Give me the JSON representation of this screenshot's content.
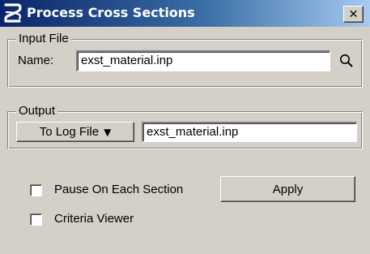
{
  "window": {
    "title": "Process Cross Sections",
    "close_glyph": "✕",
    "app_icon": "bentley-b-icon"
  },
  "input_file": {
    "group_label": "Input File",
    "name_label": "Name:",
    "name_value": "exst_material.inp",
    "browse_icon": "magnifier-icon"
  },
  "output": {
    "group_label": "Output",
    "mode_button_label": "To Log File",
    "mode_arrow": "▼",
    "file_value": "exst_material.inp"
  },
  "options": {
    "pause_label": "Pause On Each Section",
    "pause_checked": false,
    "criteria_label": "Criteria Viewer",
    "criteria_checked": false
  },
  "actions": {
    "apply_label": "Apply"
  },
  "colors": {
    "dialog_face": "#d4d0c8",
    "title_start": "#0a246a",
    "title_end": "#a6caf0",
    "title_text": "#ffffff"
  }
}
